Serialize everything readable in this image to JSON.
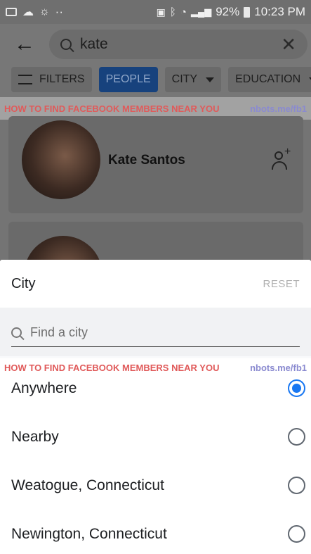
{
  "status_bar": {
    "battery": "92%",
    "time": "10:23 PM",
    "dots": "··"
  },
  "header": {
    "search_value": "kate",
    "back_icon": "arrow-left-icon",
    "clear_icon": "close-icon"
  },
  "filter_chips": [
    {
      "label": "FILTERS",
      "active": false
    },
    {
      "label": "PEOPLE",
      "active": true
    },
    {
      "label": "CITY",
      "active": false
    },
    {
      "label": "EDUCATION",
      "active": false
    }
  ],
  "watermark": {
    "left": "HOW TO FIND FACEBOOK MEMBERS NEAR YOU",
    "right": "nbots.me/fb1"
  },
  "results": [
    {
      "name": "Kate Santos"
    }
  ],
  "sheet": {
    "title": "City",
    "reset_label": "RESET",
    "search_placeholder": "Find a city",
    "options": [
      {
        "label": "Anywhere",
        "selected": true
      },
      {
        "label": "Nearby",
        "selected": false
      },
      {
        "label": "Weatogue, Connecticut",
        "selected": false
      },
      {
        "label": "Newington, Connecticut",
        "selected": false
      }
    ]
  },
  "colors": {
    "accent": "#1877f2",
    "watermark_red": "#e05a5a",
    "watermark_blue": "#8a8ad0"
  }
}
